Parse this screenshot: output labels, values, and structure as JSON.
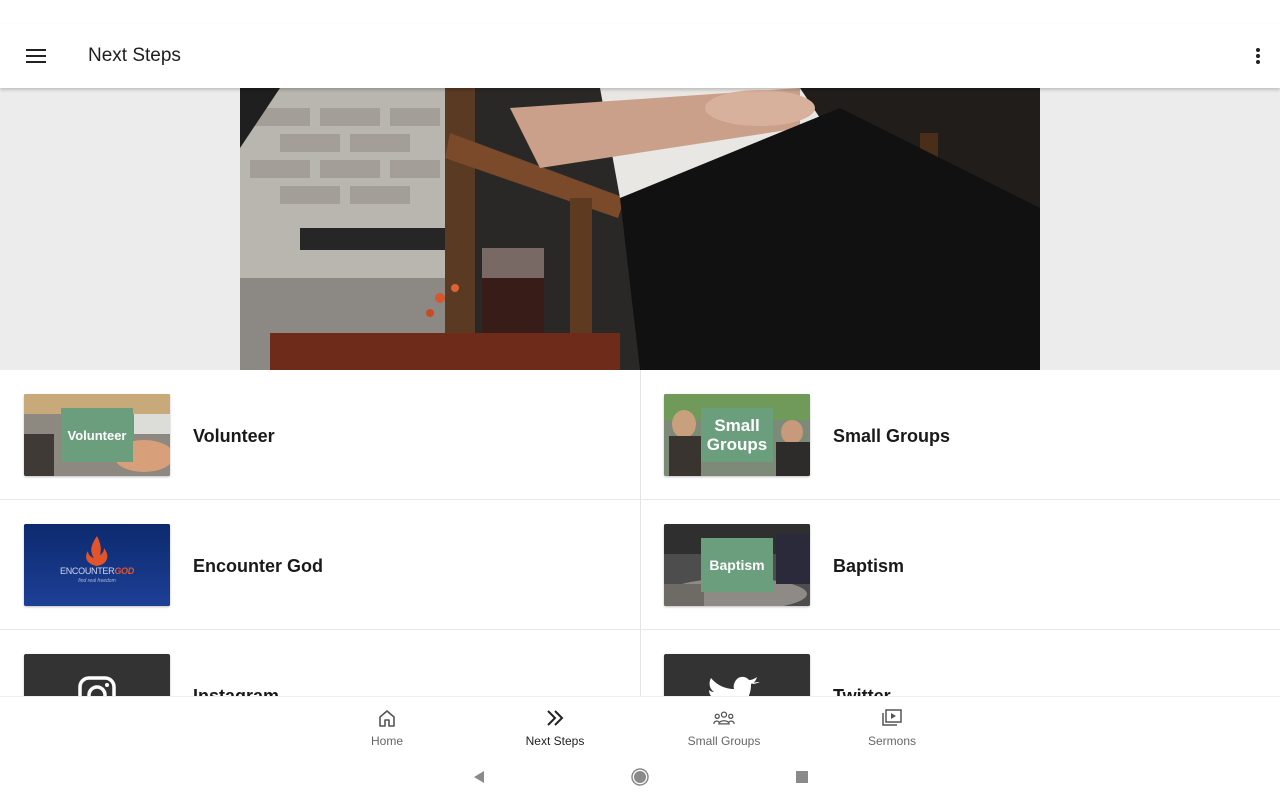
{
  "app_bar": {
    "title": "Next Steps",
    "menu_icon": "hamburger-menu-icon",
    "overflow_icon": "more-vertical-icon"
  },
  "tiles": [
    {
      "label": "Volunteer",
      "thumb_text": "Volunteer"
    },
    {
      "label": "Small Groups",
      "thumb_text_line1": "Small",
      "thumb_text_line2": "Groups"
    },
    {
      "label": "Encounter God",
      "thumb_text_main": "ENCOUNTER",
      "thumb_text_accent": "GOD",
      "thumb_tagline": "find real freedom"
    },
    {
      "label": "Baptism",
      "thumb_text": "Baptism"
    },
    {
      "label": "Instagram",
      "icon": "instagram-icon"
    },
    {
      "label": "Twitter",
      "icon": "twitter-bird-icon"
    }
  ],
  "bottom_nav": [
    {
      "label": "Home",
      "icon": "home-icon",
      "active": false
    },
    {
      "label": "Next Steps",
      "icon": "double-chevron-right-icon",
      "active": true
    },
    {
      "label": "Small Groups",
      "icon": "people-group-icon",
      "active": false
    },
    {
      "label": "Sermons",
      "icon": "video-library-icon",
      "active": false
    }
  ],
  "colors": {
    "badge_green": "#6a9e7c",
    "encounter_blue": "#14337a",
    "social_tile": "#333333"
  }
}
